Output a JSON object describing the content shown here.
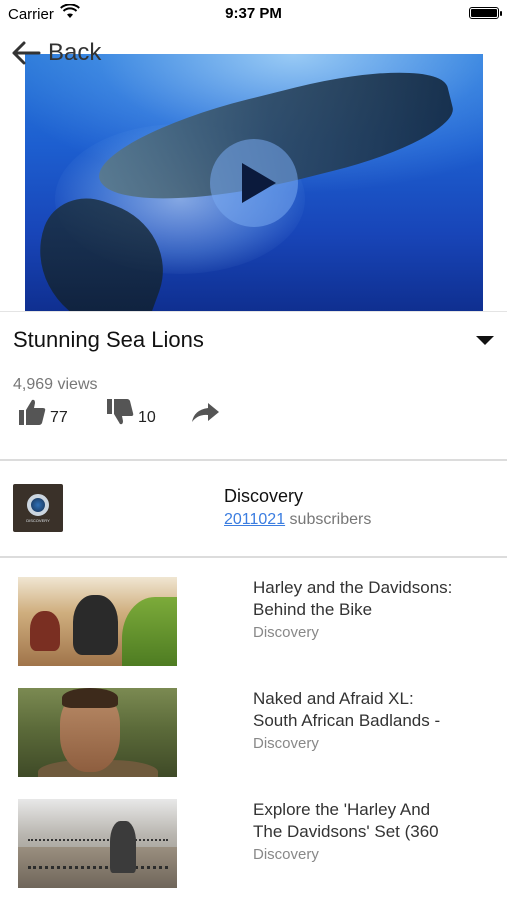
{
  "status_bar": {
    "carrier": "Carrier",
    "time": "9:37 PM"
  },
  "nav": {
    "back_label": "Back"
  },
  "video": {
    "title": "Stunning Sea Lions",
    "views": "4,969 views",
    "likes": "77",
    "dislikes": "10"
  },
  "channel": {
    "name": "Discovery",
    "subscriber_count": "2011021",
    "subscriber_suffix": " subscribers",
    "logo_text": "DISCOVERY"
  },
  "related": [
    {
      "title_lines": [
        "Harley and the Davidsons:",
        "Behind the Bike"
      ],
      "channel": "Discovery"
    },
    {
      "title_lines": [
        "Naked and Afraid XL:",
        "South African Badlands -"
      ],
      "channel": "Discovery"
    },
    {
      "title_lines": [
        "Explore the 'Harley And",
        "The Davidsons' Set (360"
      ],
      "channel": "Discovery"
    }
  ],
  "colors": {
    "link": "#3b7de0",
    "muted_text": "#777777",
    "divider": "#dcdcdc"
  }
}
